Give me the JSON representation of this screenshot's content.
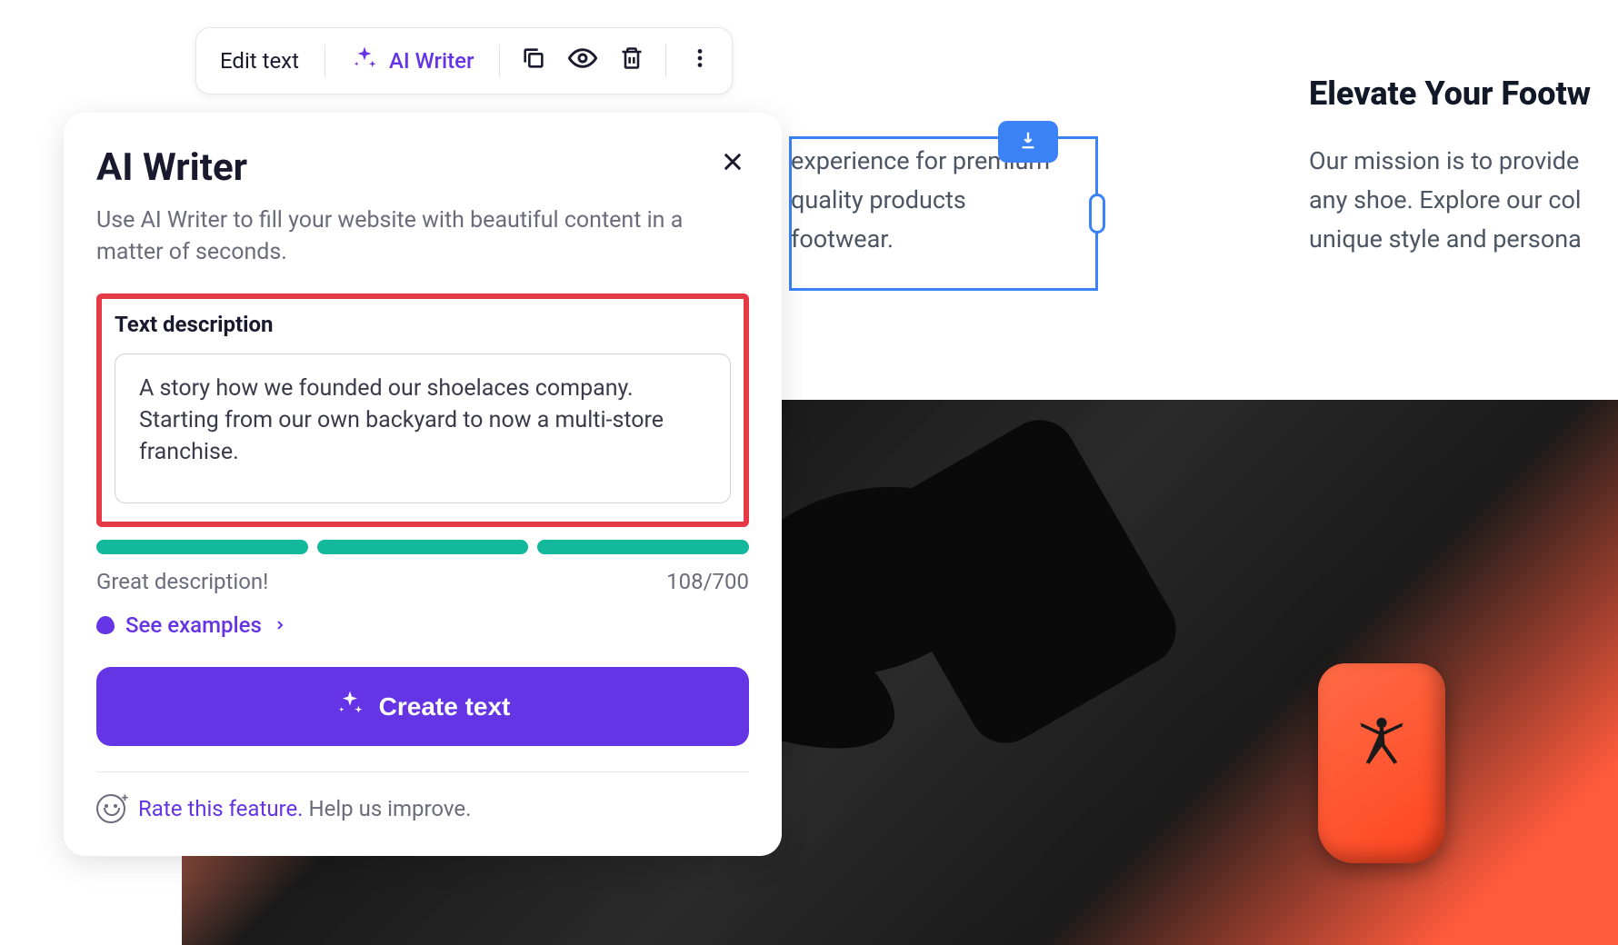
{
  "toolbar": {
    "edit_text": "Edit text",
    "ai_writer": "AI Writer"
  },
  "panel": {
    "title": "AI Writer",
    "subtitle": "Use AI Writer to fill your website with beautiful content in a matter of seconds.",
    "desc_label": "Text description",
    "desc_value": "A story how we founded our shoelaces company. Starting from our own backyard to now a multi-store franchise.",
    "status_text": "Great description!",
    "char_count": "108/700",
    "see_examples": "See examples",
    "create_button": "Create text",
    "rate_link": "Rate this feature.",
    "rate_help": "Help us improve."
  },
  "background": {
    "heading": "Elevate Your Footw",
    "text1_line1": "experience for premium",
    "text1_line2": "quality products",
    "text1_line3": "footwear.",
    "text2_line1": "Our mission is to provide",
    "text2_line2": "any shoe. Explore our col",
    "text2_line3": "unique style and persona"
  }
}
